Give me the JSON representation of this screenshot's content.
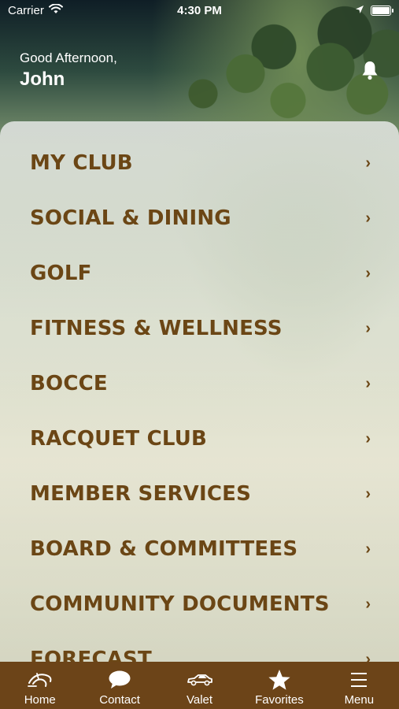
{
  "status_bar": {
    "carrier": "Carrier",
    "time": "4:30 PM"
  },
  "header": {
    "greeting": "Good Afternoon,",
    "name": "John",
    "bell_icon": "bell-icon"
  },
  "menu": {
    "items": [
      {
        "label": "MY CLUB"
      },
      {
        "label": "SOCIAL & DINING"
      },
      {
        "label": "GOLF"
      },
      {
        "label": "FITNESS & WELLNESS"
      },
      {
        "label": "BOCCE"
      },
      {
        "label": "RACQUET CLUB"
      },
      {
        "label": "MEMBER SERVICES"
      },
      {
        "label": "BOARD & COMMITTEES"
      },
      {
        "label": "COMMUNITY DOCUMENTS"
      },
      {
        "label": "FORECAST"
      }
    ],
    "chevron": "›"
  },
  "tab_bar": {
    "tabs": [
      {
        "label": "Home",
        "icon": "home-logo-icon"
      },
      {
        "label": "Contact",
        "icon": "chat-bubble-icon"
      },
      {
        "label": "Valet",
        "icon": "car-icon"
      },
      {
        "label": "Favorites",
        "icon": "star-icon"
      },
      {
        "label": "Menu",
        "icon": "hamburger-menu-icon"
      }
    ]
  },
  "colors": {
    "brand_brown": "#6c4418",
    "menu_text": "#6b4615"
  }
}
